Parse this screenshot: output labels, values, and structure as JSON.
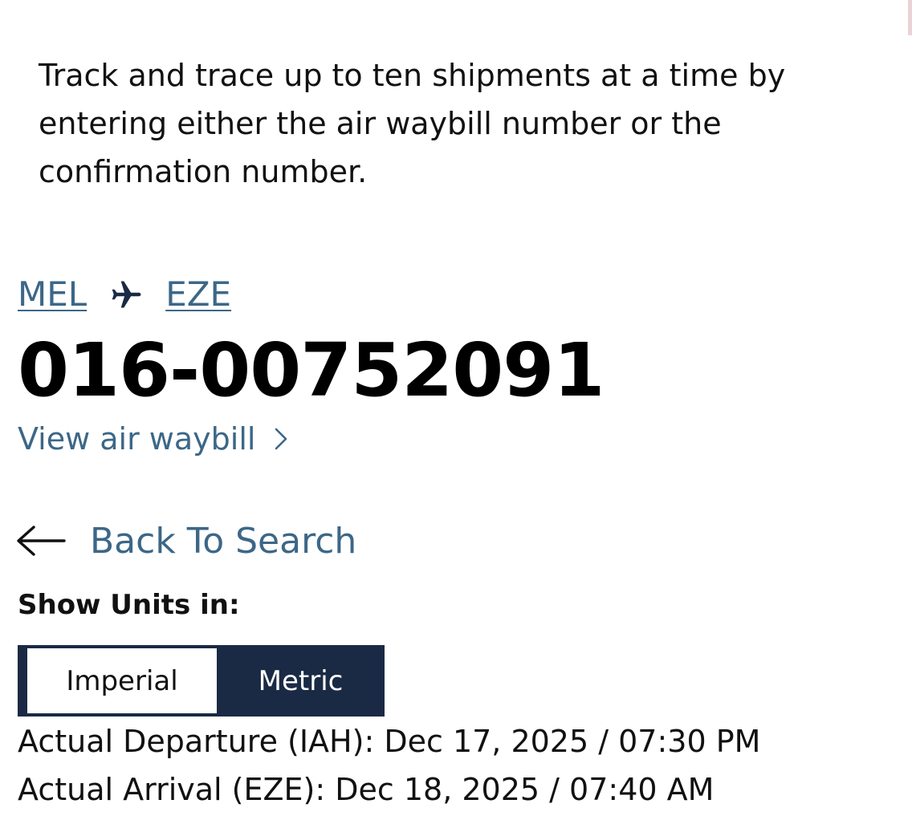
{
  "intro_text": "Track and trace up to ten shipments at a time by entering either the air waybill number or the confirmation number.",
  "route": {
    "origin": "MEL",
    "destination": "EZE",
    "icon": "airplane-icon"
  },
  "air_waybill_number": "016-00752091",
  "view_awb_label": "View air waybill",
  "back_to_search_label": "Back To Search",
  "units": {
    "label": "Show Units in:",
    "options": [
      "Imperial",
      "Metric"
    ],
    "selected": "Metric"
  },
  "flight_times": {
    "actual_departure": "Actual Departure (IAH): Dec 17, 2025 / 07:30 PM",
    "actual_arrival": "Actual Arrival (EZE): Dec 18, 2025 / 07:40 AM"
  },
  "colors": {
    "link": "#3c6787",
    "toggle_selected_bg": "#1a2a45",
    "toggle_selected_text": "#ffffff"
  }
}
